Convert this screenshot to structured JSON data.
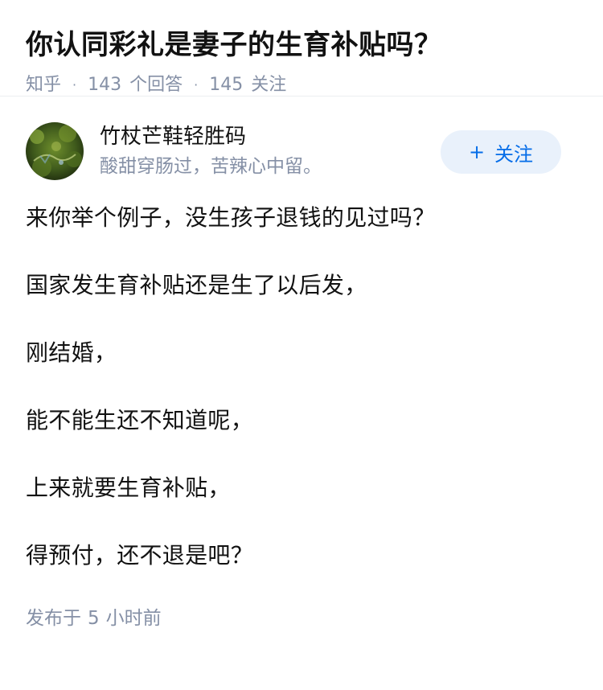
{
  "question": {
    "title": "你认同彩礼是妻子的生育补贴吗？",
    "source": "知乎",
    "answer_count": "143",
    "answer_label": "个回答",
    "follower_count": "145",
    "follower_label": "关注"
  },
  "answer": {
    "author": {
      "name": "竹杖芒鞋轻胜码",
      "bio": "酸甜穿肠过，苦辣心中留。",
      "avatar_icon": "avatar-image"
    },
    "follow_button": {
      "icon": "+",
      "label": "关注"
    },
    "paragraphs": [
      "来你举个例子，没生孩子退钱的见过吗？",
      "国家发生育补贴还是生了以后发，",
      "刚结婚，",
      "能不能生还不知道呢，",
      "上来就要生育补贴，",
      "得预付，还不退是吧？"
    ],
    "publish": {
      "prefix": "发布于",
      "number": "5",
      "unit": "小时前"
    }
  },
  "colors": {
    "accent": "#056de8",
    "follow_bg": "#e9f1fb",
    "meta": "#8590a6",
    "text": "#121212"
  }
}
